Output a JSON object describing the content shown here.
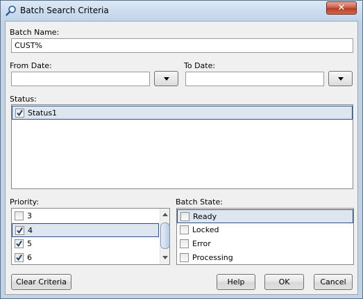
{
  "window": {
    "title": "Batch Search Criteria",
    "close_symbol": "✕"
  },
  "batch_name": {
    "label": "Batch Name:",
    "value": "CUST%"
  },
  "from_date": {
    "label": "From Date:",
    "value": ""
  },
  "to_date": {
    "label": "To Date:",
    "value": ""
  },
  "status": {
    "label": "Status:",
    "items": [
      {
        "label": "Status1",
        "checked": true
      }
    ]
  },
  "priority": {
    "label": "Priority:",
    "items": [
      {
        "label": "3",
        "checked": false
      },
      {
        "label": "4",
        "checked": true
      },
      {
        "label": "5",
        "checked": true
      },
      {
        "label": "6",
        "checked": true
      }
    ]
  },
  "batch_state": {
    "label": "Batch State:",
    "items": [
      {
        "label": "Ready",
        "checked": false
      },
      {
        "label": "Locked",
        "checked": false
      },
      {
        "label": "Error",
        "checked": false
      },
      {
        "label": "Processing",
        "checked": false
      }
    ]
  },
  "buttons": {
    "clear_criteria": "Clear Criteria",
    "help": "Help",
    "ok": "OK",
    "cancel": "Cancel"
  }
}
